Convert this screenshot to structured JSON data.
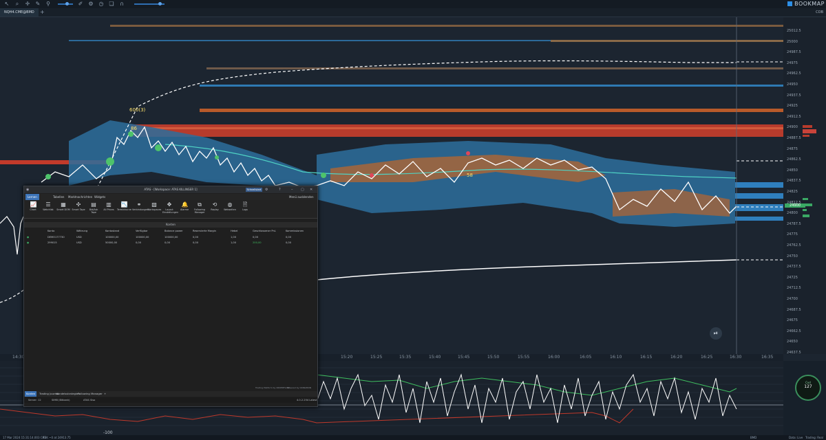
{
  "app": {
    "brand": "BOOKMAP",
    "tab": "NQH4.CME@BMD",
    "tab_add": "+",
    "cob": "COB"
  },
  "chart": {
    "y_ticks": [
      "25012.5",
      "25000",
      "24987.5",
      "24975",
      "24962.5",
      "24950",
      "24937.5",
      "24925",
      "24912.5",
      "24900",
      "24887.5",
      "24875",
      "24862.5",
      "24850",
      "24837.5",
      "24825",
      "24812.5",
      "24800",
      "24787.5",
      "24775",
      "24762.5",
      "24750",
      "24737.5",
      "24725",
      "24712.5",
      "24700",
      "24687.5",
      "24675",
      "24662.5",
      "24650",
      "24637.5"
    ],
    "x_ticks": [
      "14:30",
      "15:20",
      "15:25",
      "15:35",
      "15:40",
      "15:45",
      "15:50",
      "15:55",
      "16:00",
      "16:05",
      "16:10",
      "16:15",
      "16:20",
      "16:25",
      "16:30",
      "16:35"
    ],
    "labels": {
      "l600": "600(3)",
      "l86": "86",
      "l58": "58"
    },
    "price_badge": "24900"
  },
  "lower": {
    "min_label": "-100",
    "gauge_title": "Cvd",
    "gauge_value": "127"
  },
  "status": {
    "datetime": "17 Mar 2024 15:31:14.003 CET",
    "ask": "ASK ~0 at 24913.75",
    "bmd": "BMD",
    "data": "Data: Live",
    "trading": "Trading: Real"
  },
  "atas": {
    "title": "ATAS - [Workspace: ATAS KILLINGER 1]",
    "schedule_btn": "Schnellstart",
    "menu": {
      "lernen": "Lernen",
      "tabellen": "Tabellen",
      "marktnachrichten": "Marktnachrichten",
      "widgets": "Widgets",
      "menu_ausblenden": "Menü ausblenden"
    },
    "ribbon": [
      {
        "label": "Chart",
        "icon": "📈"
      },
      {
        "label": "Watchlist",
        "icon": "☰"
      },
      {
        "label": "Smart DOM",
        "icon": "▦"
      },
      {
        "label": "Smart Tape",
        "icon": "✣"
      },
      {
        "label": "Bid/Ask Tape",
        "icon": "▤"
      },
      {
        "label": "All Prices",
        "icon": "▥"
      },
      {
        "label": "Terminkurve",
        "icon": "📉"
      },
      {
        "label": "Verbindungen",
        "icon": "⚭"
      },
      {
        "label": "Workspaces",
        "icon": "▧"
      },
      {
        "label": "Layout Einstellungen",
        "icon": "✥"
      },
      {
        "label": "Alarme",
        "icon": "🔔"
      },
      {
        "label": "Following Manager",
        "icon": "⧉"
      },
      {
        "label": "Replay",
        "icon": "⟲"
      },
      {
        "label": "Webseiten",
        "icon": "◍"
      },
      {
        "label": "Logs",
        "icon": "🗎"
      }
    ],
    "panel_title": "Konten",
    "columns": [
      "Konto",
      "Währung",
      "Kontostand",
      "Verfügbar",
      "Balance power",
      "Reservierte Margin",
      "Hebel",
      "Geschlossener PnL",
      "Kommissionen"
    ],
    "rows": [
      [
        "DEMO177730",
        "USD",
        "100000,00",
        "100000,00",
        "100000,00",
        "0,00",
        "1,00",
        "0,00",
        "0,00"
      ],
      [
        "299015",
        "USD",
        "50000,00",
        "0,00",
        "0,00",
        "0,00",
        "1,00",
        "200,00",
        "0,00"
      ]
    ],
    "footer_left": "Trading Platform by ORDERFLOW",
    "footer_right": "Powered by CINNAMON",
    "bottom_tabs": [
      "Konten",
      "Trading Journal",
      "Handelsstrategien",
      "Following Manager"
    ],
    "bottom_add": "+",
    "statusbar": {
      "server": "Server: 12",
      "mode": "SIMB (Bitbank)",
      "atas": "ATAS Siso",
      "version": "4.0.2.254 Latest"
    }
  }
}
